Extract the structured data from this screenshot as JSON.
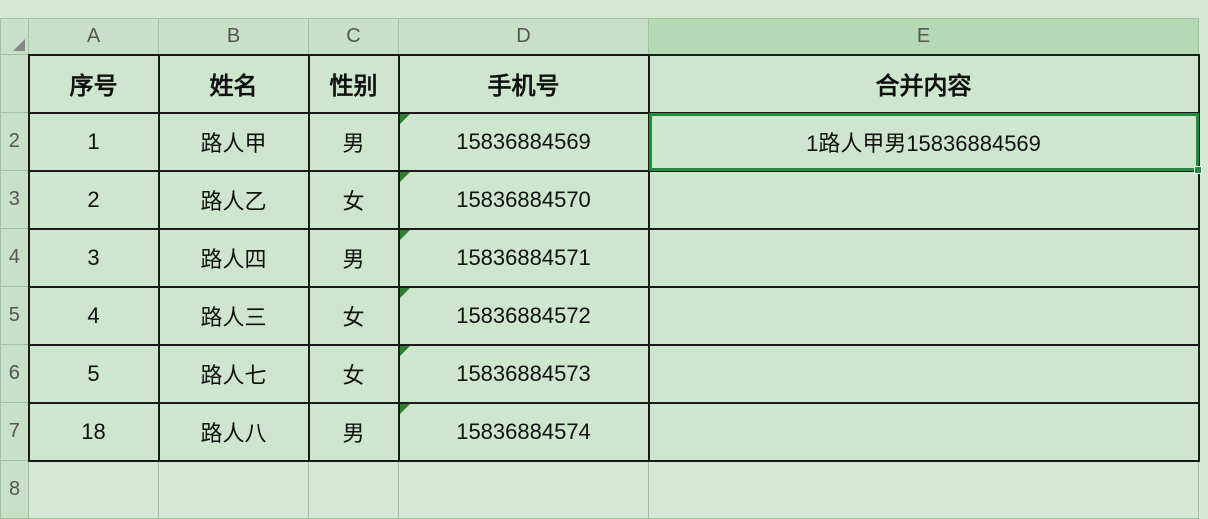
{
  "columns": {
    "A": "A",
    "B": "B",
    "C": "C",
    "D": "D",
    "E": "E"
  },
  "rows": [
    "",
    "2",
    "3",
    "4",
    "5",
    "6",
    "7",
    "8"
  ],
  "headers": {
    "seq": "序号",
    "name": "姓名",
    "gender": "性别",
    "phone": "手机号",
    "merged": "合并内容"
  },
  "data": [
    {
      "seq": "1",
      "name": "路人甲",
      "gender": "男",
      "phone": "15836884569",
      "merged": "1路人甲男15836884569"
    },
    {
      "seq": "2",
      "name": "路人乙",
      "gender": "女",
      "phone": "15836884570",
      "merged": ""
    },
    {
      "seq": "3",
      "name": "路人四",
      "gender": "男",
      "phone": "15836884571",
      "merged": ""
    },
    {
      "seq": "4",
      "name": "路人三",
      "gender": "女",
      "phone": "15836884572",
      "merged": ""
    },
    {
      "seq": "5",
      "name": "路人七",
      "gender": "女",
      "phone": "15836884573",
      "merged": ""
    },
    {
      "seq": "18",
      "name": "路人八",
      "gender": "男",
      "phone": "15836884574",
      "merged": ""
    }
  ]
}
